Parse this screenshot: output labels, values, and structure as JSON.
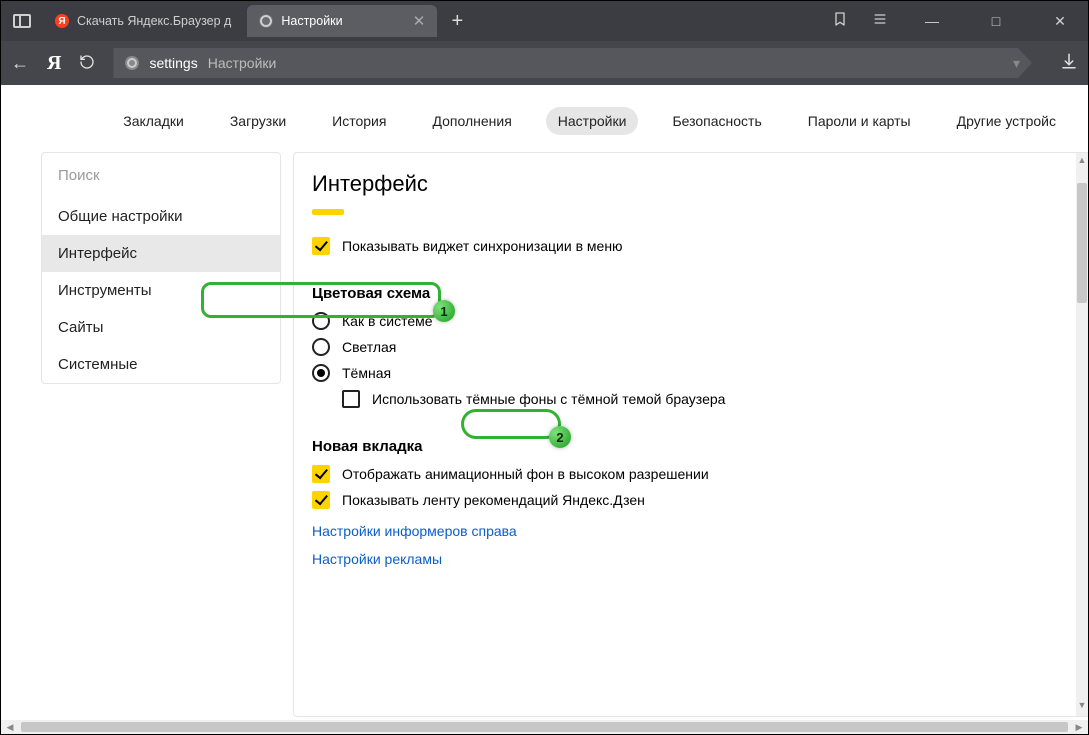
{
  "window": {
    "minimize": "—",
    "maximize": "□",
    "close": "✕"
  },
  "tabs": [
    {
      "title": "Скачать Яндекс.Браузер д",
      "icon": "Я"
    },
    {
      "title": "Настройки",
      "close": "✕"
    }
  ],
  "newtab": "+",
  "toolbar": {
    "bookmark_menu": "⌂",
    "menu": "≡"
  },
  "nav": {
    "back": "←",
    "yandex": "Я",
    "reload": "↻",
    "addr_key": "settings",
    "addr_title": "Настройки",
    "download": "⤓"
  },
  "subtabs": [
    "Закладки",
    "Загрузки",
    "История",
    "Дополнения",
    "Настройки",
    "Безопасность",
    "Пароли и карты",
    "Другие устройс"
  ],
  "subtab_active_index": 4,
  "sidebar": {
    "search_placeholder": "Поиск",
    "items": [
      "Общие настройки",
      "Интерфейс",
      "Инструменты",
      "Сайты",
      "Системные"
    ],
    "active_index": 1
  },
  "main": {
    "title": "Интерфейс",
    "sync_widget": "Показывать виджет синхронизации в меню",
    "color_scheme_header": "Цветовая схема",
    "color_options": [
      "Как в системе",
      "Светлая",
      "Тёмная"
    ],
    "color_selected_index": 2,
    "dark_bg_checkbox": "Использовать тёмные фоны с тёмной темой браузера",
    "new_tab_header": "Новая вкладка",
    "new_tab_opt1": "Отображать анимационный фон в высоком разрешении",
    "new_tab_opt2": "Показывать ленту рекомендаций Яндекс.Дзен",
    "link_informers": "Настройки информеров справа",
    "link_ads": "Настройки рекламы"
  },
  "callouts": {
    "step1": "1",
    "step2": "2"
  }
}
